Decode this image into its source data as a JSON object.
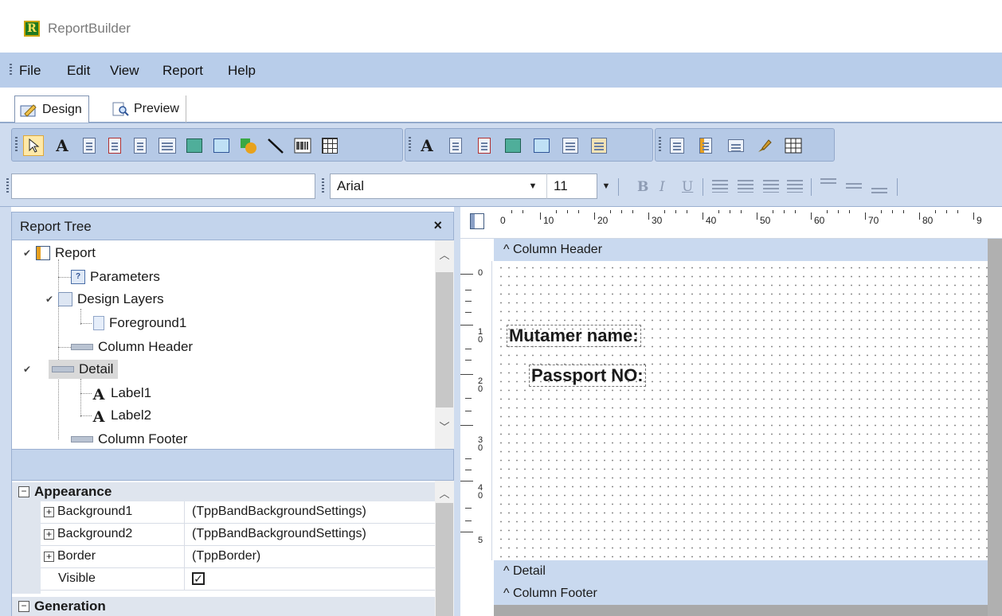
{
  "app": {
    "title": "ReportBuilder",
    "logo_letter": "R"
  },
  "menu": [
    "File",
    "Edit",
    "View",
    "Report",
    "Help"
  ],
  "tabs": [
    {
      "label": "Design",
      "active": true
    },
    {
      "label": "Preview",
      "active": false
    }
  ],
  "font_toolbar": {
    "style_value": "",
    "font_name": "Arial",
    "font_size": "11"
  },
  "report_tree": {
    "title": "Report Tree",
    "close_glyph": "×",
    "nodes": [
      {
        "label": "Report",
        "icon": "report-icon"
      },
      {
        "label": "Parameters",
        "icon": "parameters-icon"
      },
      {
        "label": "Design Layers",
        "icon": "layers-icon"
      },
      {
        "label": "Foreground1",
        "icon": "page-icon"
      },
      {
        "label": "Column Header",
        "icon": "band-icon"
      },
      {
        "label": "Detail",
        "icon": "band-icon",
        "selected": true
      },
      {
        "label": "Label1",
        "icon": "label-icon"
      },
      {
        "label": "Label2",
        "icon": "label-icon"
      },
      {
        "label": "Column Footer",
        "icon": "band-icon"
      }
    ]
  },
  "properties": {
    "categories": [
      {
        "name": "Appearance",
        "rows": [
          {
            "name": "Background1",
            "value": "(TppBandBackgroundSettings)"
          },
          {
            "name": "Background2",
            "value": "(TppBandBackgroundSettings)"
          },
          {
            "name": "Border",
            "value": "(TppBorder)"
          },
          {
            "name": "Visible",
            "value": "checked"
          }
        ]
      },
      {
        "name": "Generation",
        "rows": []
      }
    ]
  },
  "designer": {
    "ruler_labels": [
      "0",
      "10",
      "20",
      "30",
      "40",
      "50",
      "60",
      "70",
      "80",
      "9"
    ],
    "vruler_labels": [
      "0",
      "1\n0",
      "2\n0",
      "3\n0",
      "4\n0",
      "5"
    ],
    "bands": {
      "column_header": "Column Header",
      "detail": "Detail",
      "column_footer": "Column Footer"
    },
    "band_caret": "^",
    "labels": {
      "label1": "Mutamer name:",
      "label2": "Passport NO:"
    }
  },
  "colors": {
    "menu_bg": "#b8cdea",
    "toolbar_bg": "#cfdcef",
    "band_bg": "#c9d9ef",
    "selection": "#ffe9a8"
  }
}
